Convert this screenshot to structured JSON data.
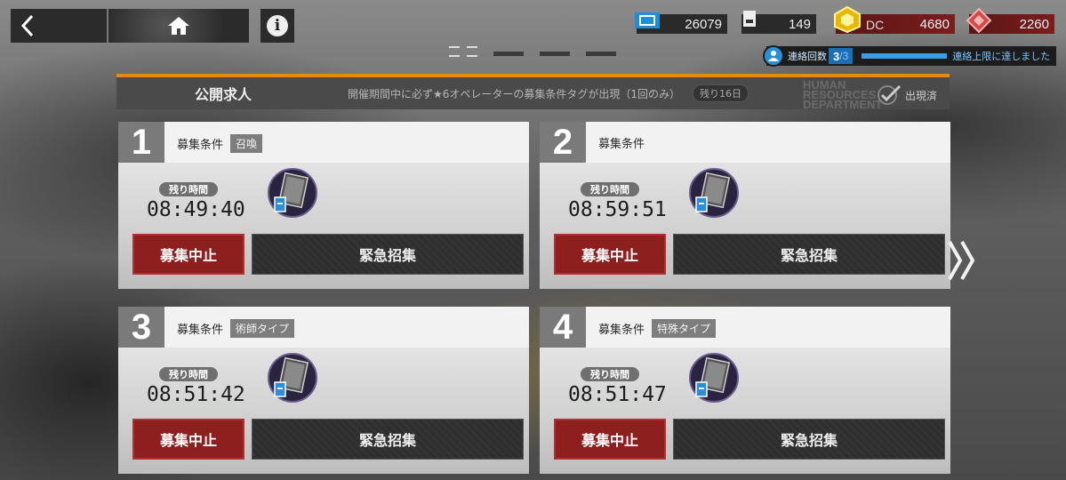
{
  "topbar": {
    "back_icon": "chevron-left-icon",
    "home_icon": "home-icon",
    "info_label": "i"
  },
  "resources": [
    {
      "name": "lmd",
      "icon": "lmd-icon",
      "value": "26079",
      "color": "#1c8fd6"
    },
    {
      "name": "recruitment-permit",
      "icon": "permit-icon",
      "value": "149",
      "color": "#dddddd"
    },
    {
      "name": "gold",
      "icon": "gold-icon",
      "value": "4680",
      "color": "#e6b800"
    },
    {
      "name": "originite",
      "icon": "originite-icon",
      "value": "2260",
      "color": "#d24a4a"
    }
  ],
  "contact": {
    "label": "連絡回数",
    "count": "3",
    "max": "/3",
    "limit_text": "連絡上限に達しました"
  },
  "header": {
    "title": "公開求人",
    "notice": "開催期間中に必ず★6オペレーターの募集条件タグが出現（1回のみ）",
    "remaining": "残り16日",
    "watermark": "HUMAN RESOURCES DEPARTMENT",
    "appeared": "出現済"
  },
  "slots": [
    {
      "number": "1",
      "condition_label": "募集条件",
      "tag": "召喚",
      "time_label": "残り時間",
      "time": "08:49:40",
      "stop_label": "募集中止",
      "expedite_label": "緊急招集"
    },
    {
      "number": "2",
      "condition_label": "募集条件",
      "tag": "",
      "time_label": "残り時間",
      "time": "08:59:51",
      "stop_label": "募集中止",
      "expedite_label": "緊急招集"
    },
    {
      "number": "3",
      "condition_label": "募集条件",
      "tag": "術師タイプ",
      "time_label": "残り時間",
      "time": "08:51:42",
      "stop_label": "募集中止",
      "expedite_label": "緊急招集"
    },
    {
      "number": "4",
      "condition_label": "募集条件",
      "tag": "特殊タイプ",
      "time_label": "残り時間",
      "time": "08:51:47",
      "stop_label": "募集中止",
      "expedite_label": "緊急招集"
    }
  ],
  "accent_color": "#e48a10"
}
